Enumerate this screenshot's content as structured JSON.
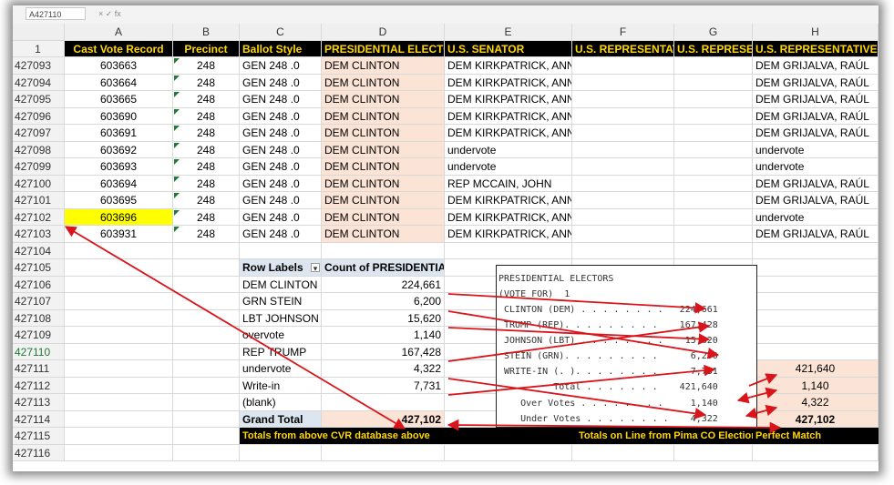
{
  "toolbar": {
    "name_box": "A427110",
    "formula_glyphs": "× ✓ fx"
  },
  "columns": [
    "A",
    "B",
    "C",
    "D",
    "E",
    "F",
    "G",
    "H"
  ],
  "header_row": {
    "num": "1",
    "cells": [
      "Cast Vote Record",
      "Precinct",
      "Ballot Style",
      "PRESIDENTIAL ELECTOR",
      "U.S. SENATOR",
      "U.S. REPRESENTATIV",
      "U.S. REPRESENT",
      "U.S. REPRESENTATIVE IN"
    ]
  },
  "data_rows": [
    {
      "num": "427093",
      "cvr": "603663",
      "precinct": "248",
      "style": "GEN 248 .0",
      "pres": "DEM CLINTON",
      "senator": "DEM KIRKPATRICK, ANN",
      "repH": "DEM GRIJALVA, RAÚL"
    },
    {
      "num": "427094",
      "cvr": "603664",
      "precinct": "248",
      "style": "GEN 248 .0",
      "pres": "DEM CLINTON",
      "senator": "DEM KIRKPATRICK, ANN",
      "repH": "DEM GRIJALVA, RAÚL"
    },
    {
      "num": "427095",
      "cvr": "603665",
      "precinct": "248",
      "style": "GEN 248 .0",
      "pres": "DEM CLINTON",
      "senator": "DEM KIRKPATRICK, ANN",
      "repH": "DEM GRIJALVA, RAÚL"
    },
    {
      "num": "427096",
      "cvr": "603690",
      "precinct": "248",
      "style": "GEN 248 .0",
      "pres": "DEM CLINTON",
      "senator": "DEM KIRKPATRICK, ANN",
      "repH": "DEM GRIJALVA, RAÚL"
    },
    {
      "num": "427097",
      "cvr": "603691",
      "precinct": "248",
      "style": "GEN 248 .0",
      "pres": "DEM CLINTON",
      "senator": "DEM KIRKPATRICK, ANN",
      "repH": "DEM GRIJALVA, RAÚL"
    },
    {
      "num": "427098",
      "cvr": "603692",
      "precinct": "248",
      "style": "GEN 248 .0",
      "pres": "DEM CLINTON",
      "senator": "undervote",
      "repH": "undervote"
    },
    {
      "num": "427099",
      "cvr": "603693",
      "precinct": "248",
      "style": "GEN 248 .0",
      "pres": "DEM CLINTON",
      "senator": "undervote",
      "repH": "undervote"
    },
    {
      "num": "427100",
      "cvr": "603694",
      "precinct": "248",
      "style": "GEN 248 .0",
      "pres": "DEM CLINTON",
      "senator": "REP MCCAIN, JOHN",
      "repH": "DEM GRIJALVA, RAÚL"
    },
    {
      "num": "427101",
      "cvr": "603695",
      "precinct": "248",
      "style": "GEN 248 .0",
      "pres": "DEM CLINTON",
      "senator": "DEM KIRKPATRICK, ANN",
      "repH": "DEM GRIJALVA, RAÚL"
    },
    {
      "num": "427102",
      "cvr": "603696",
      "precinct": "248",
      "style": "GEN 248 .0",
      "pres": "DEM CLINTON",
      "senator": "DEM KIRKPATRICK, ANN",
      "repH": "undervote"
    },
    {
      "num": "427103",
      "cvr": "603931",
      "precinct": "248",
      "style": "GEN 248 .0",
      "pres": "DEM CLINTON",
      "senator": "DEM KIRKPATRICK, ANN",
      "repH": "DEM GRIJALVA, RAÚL"
    }
  ],
  "lower_row_nums": [
    "427104",
    "427105",
    "427106",
    "427107",
    "427108",
    "427109",
    "427110",
    "427111",
    "427112",
    "427113",
    "427114",
    "427115",
    "427116"
  ],
  "pivot": {
    "row_labels": "Row Labels",
    "count_label": "Count of PRESIDENTIAL ELECTOR",
    "rows": [
      {
        "label": "DEM CLINTON",
        "value": "224,661"
      },
      {
        "label": "GRN STEIN",
        "value": "6,200"
      },
      {
        "label": "LBT JOHNSON",
        "value": "15,620"
      },
      {
        "label": "overvote",
        "value": "1,140"
      },
      {
        "label": "REP TRUMP",
        "value": "167,428"
      },
      {
        "label": "undervote",
        "value": "4,322"
      },
      {
        "label": "Write-in",
        "value": "7,731"
      },
      {
        "label": "(blank)",
        "value": ""
      }
    ],
    "grand_total_label": "Grand Total",
    "grand_total": "427,102"
  },
  "side_values": [
    "421,640",
    "1,140",
    "4,322"
  ],
  "side_total": "427,102",
  "footer_notes": {
    "cvr": "Totals from above CVR database above",
    "pima": "Totals on Line from Pima CO Elections",
    "match": "Perfect Match"
  },
  "receipt": {
    "lines": [
      "PRESIDENTIAL ELECTORS",
      "(VOTE FOR)  1",
      " CLINTON (DEM) . . . . . . . .   224,661",
      " TRUMP (REP). . . . . . . . .    167,428",
      " JOHNSON (LBT) . . . . . . . .    15,620",
      " STEIN (GRN). . . . . . . . .      6,200",
      " WRITE-IN (. ). . . . . . . .      7,731",
      "          Total . . . . . . .    421,640",
      "    Over Votes . . . . . . . .     1,140",
      "    Under Votes . . . . . . . .    4,322"
    ]
  },
  "colors": {
    "header_bg": "#000000",
    "header_text": "#ffd700",
    "peach": "#fbe4d5",
    "highlight": "#ffff00",
    "arrow": "#d9141a"
  }
}
